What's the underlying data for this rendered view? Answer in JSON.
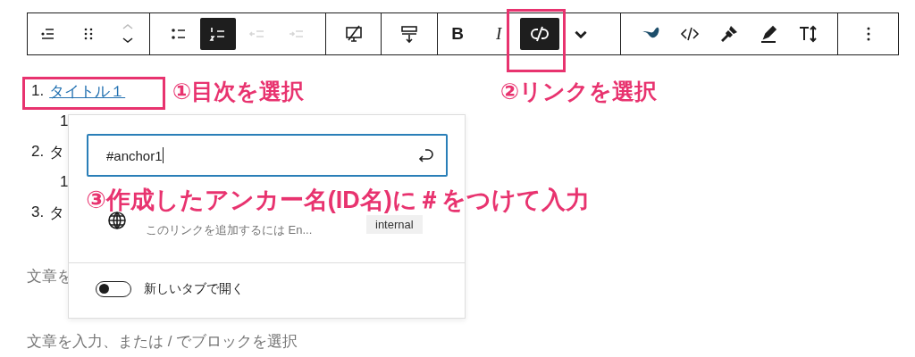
{
  "toolbar": {
    "groups": [
      {
        "buttons": [
          {
            "kind": "listview",
            "selected": false,
            "disabled": false
          },
          {
            "kind": "drag",
            "selected": false,
            "disabled": false
          },
          {
            "kind": "move",
            "selected": false,
            "disabled": false
          }
        ]
      },
      {
        "buttons": [
          {
            "kind": "bullets",
            "selected": false,
            "disabled": false
          },
          {
            "kind": "numbered",
            "selected": true,
            "disabled": false
          },
          {
            "kind": "outdent",
            "selected": false,
            "disabled": true
          },
          {
            "kind": "indent",
            "selected": false,
            "disabled": true
          }
        ]
      },
      {
        "buttons": [
          {
            "kind": "screen",
            "selected": false,
            "disabled": false
          }
        ]
      },
      {
        "buttons": [
          {
            "kind": "align",
            "selected": false,
            "disabled": false
          }
        ]
      },
      {
        "buttons": [
          {
            "kind": "bold",
            "label": "B",
            "selected": false,
            "disabled": false
          },
          {
            "kind": "italic",
            "label": "I",
            "selected": false,
            "disabled": false
          },
          {
            "kind": "link",
            "selected": true,
            "disabled": false
          },
          {
            "kind": "caret",
            "selected": false,
            "disabled": false
          }
        ]
      },
      {
        "buttons": [
          {
            "kind": "blob",
            "selected": false,
            "disabled": false
          },
          {
            "kind": "code",
            "selected": false,
            "disabled": false
          },
          {
            "kind": "brush",
            "selected": false,
            "disabled": false
          },
          {
            "kind": "marker",
            "selected": false,
            "disabled": false
          },
          {
            "kind": "textsize",
            "selected": false,
            "disabled": false
          }
        ]
      },
      {
        "buttons": [
          {
            "kind": "more",
            "selected": false,
            "disabled": false
          }
        ]
      }
    ]
  },
  "list": [
    {
      "number": "1.",
      "title": "タイトル１",
      "selected": true,
      "children": [
        {
          "number": "1"
        }
      ]
    },
    {
      "number": "2.",
      "title": "タ",
      "selected": false,
      "children": [
        {
          "number": "1"
        }
      ]
    },
    {
      "number": "3.",
      "title": "タ",
      "selected": false
    }
  ],
  "paragraphs": [
    "文章を",
    "文章を入力、または / でブロックを選択"
  ],
  "popover": {
    "input": {
      "value": "#anchor1"
    },
    "suggestion": {
      "subtitle": "このリンクを追加するには En...",
      "badge": "internal"
    },
    "toggle": {
      "label": "新しいタブで開く",
      "on": false
    }
  },
  "annotations": [
    "①目次を選択",
    "②リンクを選択",
    "③作成したアンカー名(ID名)に＃をつけて入力"
  ]
}
